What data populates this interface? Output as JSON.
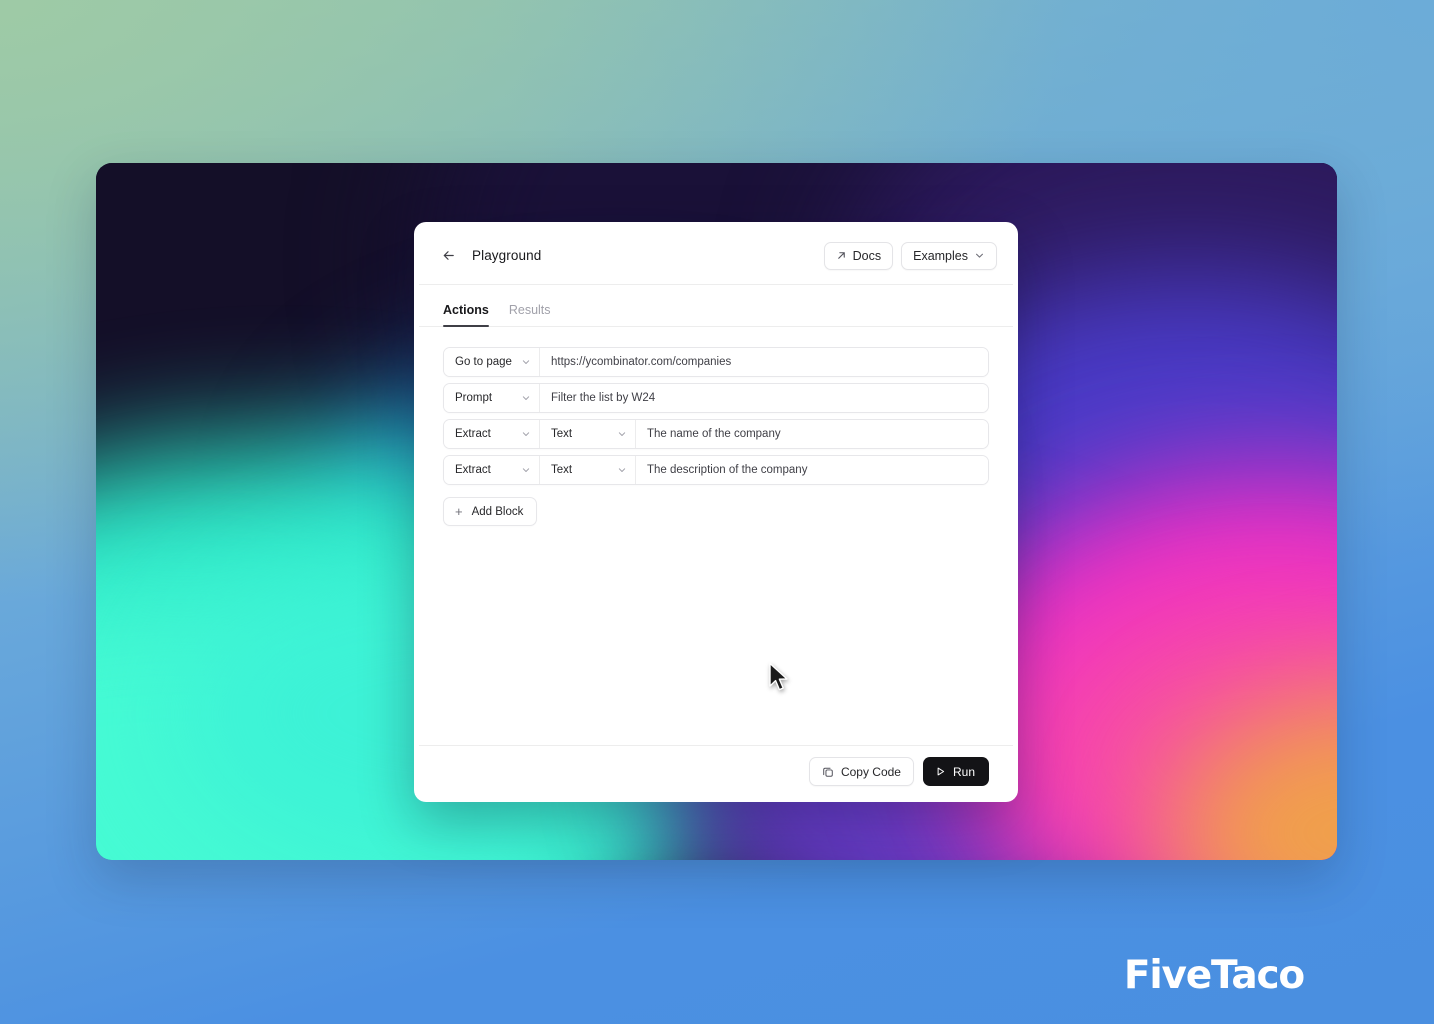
{
  "window": {
    "titlebar": {
      "back_icon": "arrow-left-icon",
      "title": "Playground",
      "docs_button": {
        "label": "Docs",
        "icon": "arrow-up-right-icon"
      },
      "examples_button": {
        "label": "Examples",
        "icon": "chevron-down-icon"
      }
    },
    "tabs": [
      {
        "label": "Actions",
        "active": true
      },
      {
        "label": "Results",
        "active": false
      }
    ],
    "blocks": [
      {
        "action": "Go to page",
        "type": null,
        "value": "https://ycombinator.com/companies"
      },
      {
        "action": "Prompt",
        "type": null,
        "value": "Filter the list by W24"
      },
      {
        "action": "Extract",
        "type": "Text",
        "value": "The name of the company"
      },
      {
        "action": "Extract",
        "type": "Text",
        "value": "The description of the company"
      }
    ],
    "add_block": {
      "label": "Add Block",
      "icon": "plus-icon"
    },
    "footer": {
      "copy_code": {
        "label": "Copy Code",
        "icon": "copy-icon"
      },
      "run": {
        "label": "Run",
        "icon": "play-icon"
      }
    }
  },
  "watermark": {
    "text": "FiveTaco"
  },
  "colors": {
    "accent_dark": "#131316",
    "tab_active": "#18181b",
    "tab_inactive": "#a1a1aa",
    "border": "#e7e7ea",
    "canvas_navy": "#140f28",
    "canvas_teal": "#46fbd4",
    "canvas_magenta": "#ef2fc6",
    "canvas_orange": "#f0a04b",
    "page_blue": "#4a90e2",
    "page_green": "#9ecaa6"
  }
}
